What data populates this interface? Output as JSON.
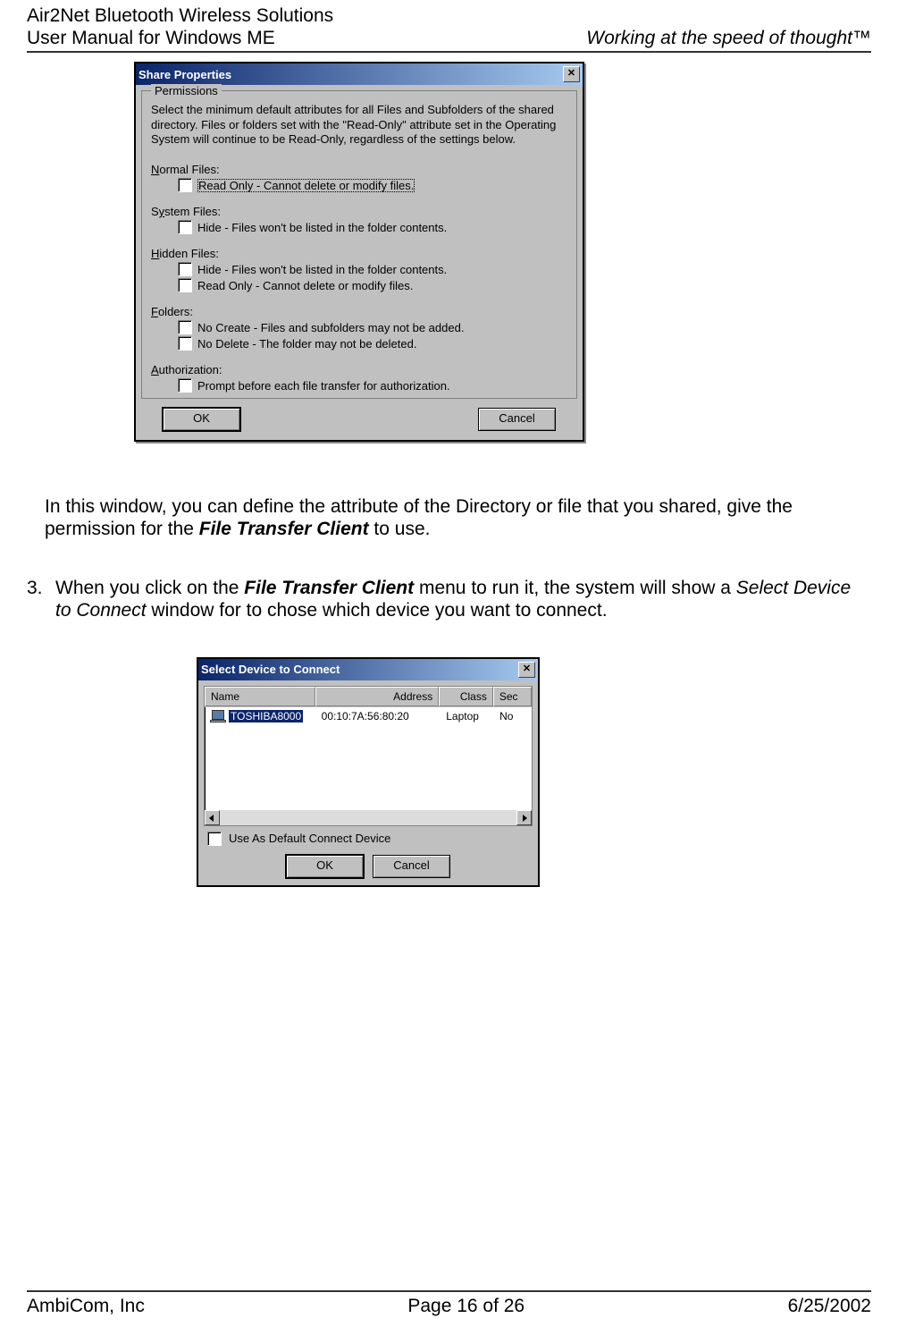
{
  "header": {
    "line1": "Air2Net Bluetooth Wireless Solutions",
    "line2": "User Manual for Windows ME",
    "right": "Working at the speed of thought™"
  },
  "footer": {
    "left": "AmbiCom, Inc",
    "center": "Page 16 of 26",
    "right": "6/25/2002"
  },
  "share_dialog": {
    "title": "Share Properties",
    "legend": "Permissions",
    "description": "Select the minimum default attributes for all Files and Subfolders of the shared directory.  Files or folders set with the \"Read-Only\" attribute set in the Operating System will continue to be Read-Only, regardless of the settings below.",
    "normal_label": "Normal Files:",
    "normal_opt1": "Read Only - Cannot delete or modify files.",
    "system_label": "System Files:",
    "system_opt1": "Hide - Files won't be listed in the folder contents.",
    "hidden_label": "Hidden Files:",
    "hidden_opt1": "Hide - Files won't be listed in the folder contents.",
    "hidden_opt2": "Read Only - Cannot delete or modify files.",
    "folders_label": "Folders:",
    "folders_opt1": "No Create - Files and subfolders may not be added.",
    "folders_opt2": "No Delete - The folder may not be deleted.",
    "auth_label": "Authorization:",
    "auth_opt1": "Prompt before each file transfer for authorization.",
    "ok": "OK",
    "cancel": "Cancel"
  },
  "paragraph1_a": "In this window, you can define the attribute of the Directory or file that you shared, give the permission for the ",
  "paragraph1_bold": "File Transfer Client",
  "paragraph1_b": "  to use.",
  "step3_num": "3.",
  "step3_a": "When you click on the ",
  "step3_bold": "File Transfer Client",
  "step3_b": " menu to run it, the system will show a ",
  "step3_italic": "Select Device to Connect",
  "step3_c": " window for to chose which device you want to connect.",
  "select_dialog": {
    "title": "Select Device to Connect",
    "col_name": "Name",
    "col_addr": "Address",
    "col_class": "Class",
    "col_sec": "Sec",
    "row_name": "TOSHIBA8000",
    "row_addr": "00:10:7A:56:80:20",
    "row_class": "Laptop",
    "row_sec": "No",
    "default_label": "Use As Default Connect Device",
    "ok": "OK",
    "cancel": "Cancel"
  }
}
